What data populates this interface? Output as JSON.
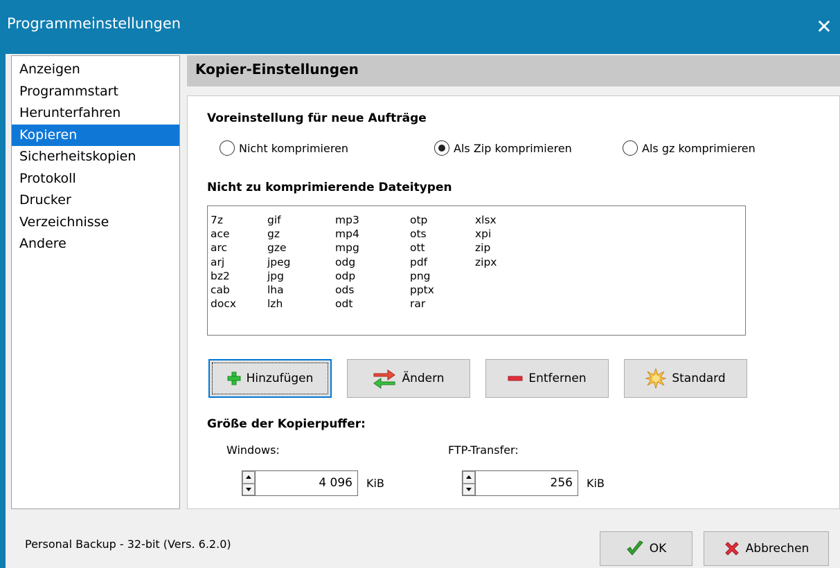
{
  "window": {
    "title": "Programmeinstellungen",
    "close_glyph": "✕"
  },
  "sidebar": {
    "items": [
      {
        "label": "Anzeigen",
        "selected": false
      },
      {
        "label": "Programmstart",
        "selected": false
      },
      {
        "label": "Herunterfahren",
        "selected": false
      },
      {
        "label": "Kopieren",
        "selected": true
      },
      {
        "label": "Sicherheitskopien",
        "selected": false
      },
      {
        "label": "Protokoll",
        "selected": false
      },
      {
        "label": "Drucker",
        "selected": false
      },
      {
        "label": "Verzeichnisse",
        "selected": false
      },
      {
        "label": "Andere",
        "selected": false
      }
    ]
  },
  "section": {
    "title": "Kopier-Einstellungen"
  },
  "compression": {
    "heading": "Voreinstellung für neue Aufträge",
    "options": [
      {
        "label": "Nicht komprimieren",
        "checked": false
      },
      {
        "label": "Als Zip komprimieren",
        "checked": true
      },
      {
        "label": "Als gz komprimieren",
        "checked": false
      }
    ]
  },
  "filetypes": {
    "heading": "Nicht zu komprimierende Dateitypen",
    "columns": [
      [
        "7z",
        "ace",
        "arc",
        "arj",
        "bz2",
        "cab",
        "docx"
      ],
      [
        "gif",
        "gz",
        "gze",
        "jpeg",
        "jpg",
        "lha",
        "lzh"
      ],
      [
        "mp3",
        "mp4",
        "mpg",
        "odg",
        "odp",
        "ods",
        "odt"
      ],
      [
        "otp",
        "ots",
        "ott",
        "pdf",
        "png",
        "pptx",
        "rar"
      ],
      [
        "xlsx",
        "xpi",
        "zip",
        "zipx"
      ]
    ]
  },
  "buttons": {
    "add": "Hinzufügen",
    "change": "Ändern",
    "remove": "Entfernen",
    "default": "Standard"
  },
  "buffer": {
    "heading": "Größe der Kopierpuffer:",
    "windows": {
      "label": "Windows:",
      "value": "4 096",
      "unit": "KiB"
    },
    "ftp": {
      "label": "FTP-Transfer:",
      "value": "256",
      "unit": "KiB"
    }
  },
  "footer": {
    "version": "Personal Backup - 32-bit (Vers. 6.2.0)",
    "ok": "OK",
    "cancel": "Abbrechen"
  },
  "colors": {
    "titlebar": "#0f7db0",
    "selection": "#0f78d7",
    "plus_icon": "#2fbf3a",
    "minus_icon": "#e0303b",
    "check_icon": "#34a434",
    "cancel_icon": "#e0303b"
  }
}
